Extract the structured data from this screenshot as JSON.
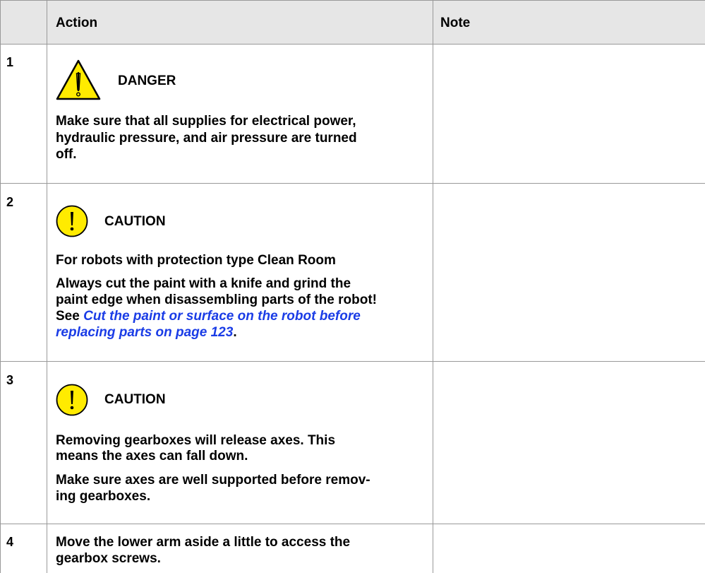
{
  "table": {
    "headers": {
      "step": "",
      "action": "Action",
      "note": "Note"
    }
  },
  "rows": [
    {
      "number": "1",
      "admonition_icon": "warning-triangle-icon",
      "admonition_label": "DANGER",
      "text_lines": [
        "Make sure that all supplies for electrical power,",
        "hydraulic pressure, and air pressure are turned",
        "off."
      ],
      "note": ""
    },
    {
      "number": "2",
      "admonition_icon": "caution-exclamation-icon",
      "admonition_label": "CAUTION",
      "subheading": "For robots with protection type Clean Room",
      "text_lines": [
        "Always cut the paint with a knife and grind the",
        "paint edge when disassembling parts of the robot!"
      ],
      "see_prefix": "See ",
      "link_lines": [
        "Cut the paint or surface on the robot before",
        "replacing parts on page 123"
      ],
      "link_suffix": ".",
      "note": ""
    },
    {
      "number": "3",
      "admonition_icon": "caution-exclamation-icon",
      "admonition_label": "CAUTION",
      "text_lines": [
        "Removing gearboxes will release axes. This",
        "means the axes can fall down."
      ],
      "text_lines_2": [
        "Make sure axes are well supported before remov-",
        "ing gearboxes."
      ],
      "note": ""
    },
    {
      "number": "4",
      "text_lines": [
        "Move the lower arm aside a little to access the",
        "gearbox screws."
      ],
      "note": ""
    }
  ],
  "colors": {
    "header_bg": "#e6e6e6",
    "grid": "#999999",
    "warning_yellow": "#ffeb00",
    "link": "#1a3ce6"
  }
}
